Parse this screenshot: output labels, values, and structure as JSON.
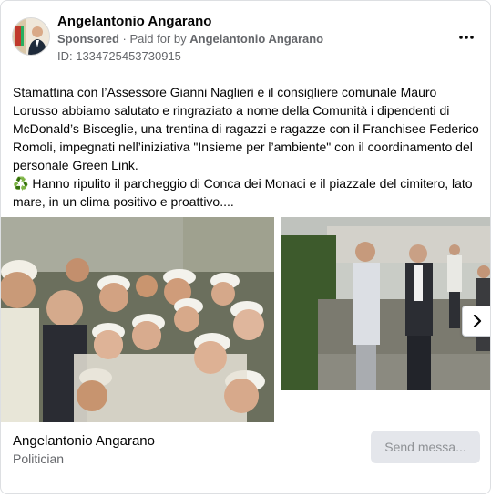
{
  "ad": {
    "page_name": "Angelantonio Angarano",
    "sponsored_label": "Sponsored",
    "paid_for_prefix": "Paid for by",
    "paid_for_name": "Angelantonio Angarano",
    "id_text": "ID: 1334725453730915",
    "more_icon": "more-horizontal-icon"
  },
  "post": {
    "paragraph1": "Stamattina con l’Assessore Gianni Naglieri e il consigliere comunale Mauro Lorusso abbiamo salutato e ringraziato a nome della Comunità i dipendenti di McDonald’s Bisceglie, una trentina di ragazzi e ragazze con il Franchisee Federico Romoli, impegnati nell’iniziativa \"Insieme per l’ambiente\" con il coordinamento del personale Green Link.",
    "recycle_glyph": "♻️",
    "paragraph2": "Hanno ripulito il parcheggio di Conca dei Monaci e il piazzale del cimitero, lato mare, in un clima positivo e proattivo...."
  },
  "carousel": {
    "next_icon": "chevron-right-icon"
  },
  "footer": {
    "name": "Angelantonio Angarano",
    "category": "Politician",
    "send_button": "Send messa..."
  },
  "colors": {
    "secondary_text": "#65676b",
    "button_bg": "#e4e6eb",
    "recycle_green": "#2e9f3a"
  }
}
